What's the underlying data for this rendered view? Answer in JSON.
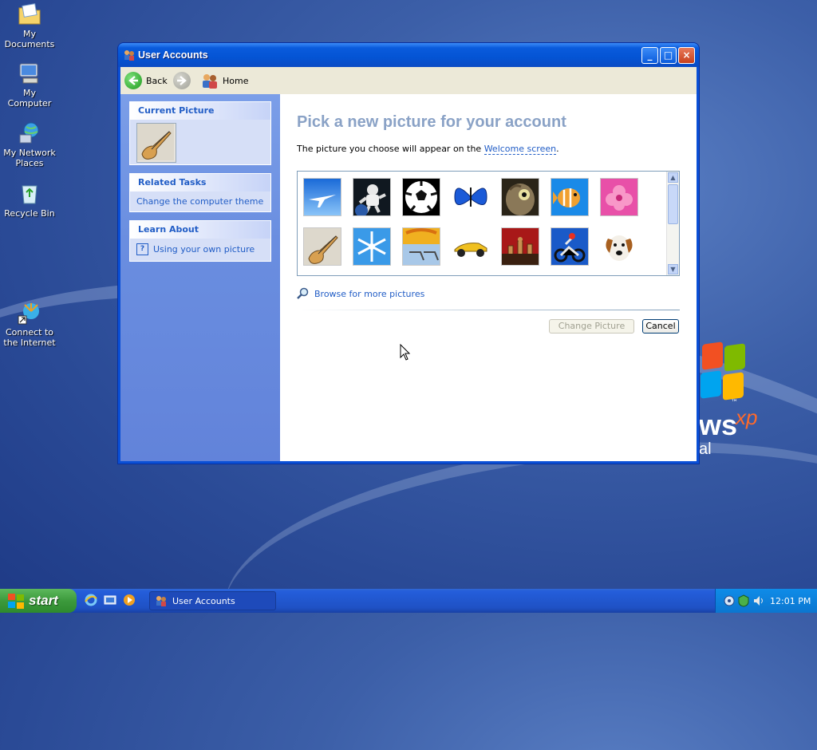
{
  "desktop": {
    "icons": [
      {
        "label": "My Documents"
      },
      {
        "label": "My Computer"
      },
      {
        "label": "My Network Places"
      },
      {
        "label": "Recycle Bin"
      },
      {
        "label": "Connect to the Internet"
      }
    ],
    "logo_text": "ws",
    "logo_sup": "xp",
    "logo_tm": "™",
    "logo_sub": "al"
  },
  "window": {
    "title": "User Accounts",
    "controls": {
      "minimize": "_",
      "maximize": "□",
      "close": "×"
    },
    "toolbar": {
      "back_label": "Back",
      "home_label": "Home"
    }
  },
  "taskpane": {
    "current_picture": {
      "heading": "Current Picture"
    },
    "related_tasks": {
      "heading": "Related Tasks",
      "items": [
        "Change the computer theme"
      ]
    },
    "learn_about": {
      "heading": "Learn About",
      "items": [
        "Using your own picture"
      ]
    }
  },
  "main": {
    "heading": "Pick a new picture for your account",
    "description_prefix": "The picture you choose will appear on the ",
    "description_link": "Welcome screen",
    "description_suffix": ".",
    "pictures": [
      {
        "name": "airplane"
      },
      {
        "name": "astronaut"
      },
      {
        "name": "soccer ball"
      },
      {
        "name": "butterfly"
      },
      {
        "name": "owl"
      },
      {
        "name": "fish"
      },
      {
        "name": "flower"
      },
      {
        "name": "guitar"
      },
      {
        "name": "snowflake"
      },
      {
        "name": "beach chairs"
      },
      {
        "name": "race car"
      },
      {
        "name": "chess"
      },
      {
        "name": "dirt bike"
      },
      {
        "name": "dog"
      }
    ],
    "browse_label": "Browse for more pictures",
    "change_button": "Change Picture",
    "cancel_button": "Cancel"
  },
  "taskbar": {
    "start_label": "start",
    "task_label": "User Accounts",
    "clock": "12:01 PM"
  },
  "colors": {
    "title_blue": "#0a5bdc",
    "taskpane_blue": "#6a8ee0",
    "link_blue": "#215dc6",
    "heading_gray_blue": "#8aa2c6",
    "start_green": "#3c9a3c"
  }
}
